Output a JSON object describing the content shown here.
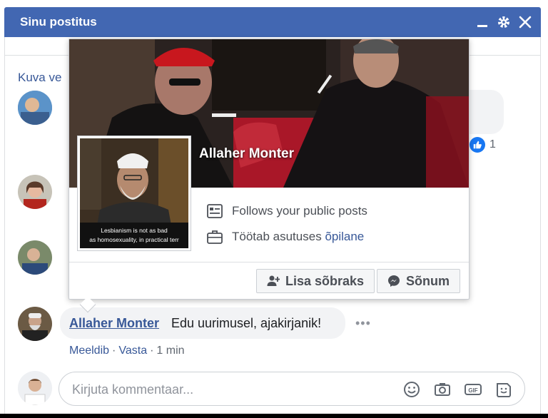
{
  "window": {
    "title": "Sinu postitus"
  },
  "thread": {
    "view_more_label": "Kuva ve",
    "like_count": "1"
  },
  "comment": {
    "author": "Allaher Monter",
    "text": "Edu uurimusel, ajakirjanik!",
    "more_label": "•••",
    "like_label": "Meeldib",
    "reply_label": "Vasta",
    "separator": "·",
    "time": "1 min"
  },
  "hovercard": {
    "name": "Allaher Monter",
    "follows_text": "Follows your public posts",
    "works_prefix": "Töötab asutuses",
    "works_link": "õpilane",
    "add_friend_label": "Lisa sõbraks",
    "message_label": "Sõnum",
    "profile_caption": "Lesbianism is not as bad as homosexuality, in practical terr"
  },
  "composer": {
    "placeholder": "Kirjuta kommentaar..."
  },
  "icons": {
    "minimize": "minimize-icon",
    "settings": "gear-icon",
    "close": "close-icon",
    "like": "thumbs-up-icon",
    "emoji": "emoji-icon",
    "camera": "camera-icon",
    "gif": "gif-icon",
    "sticker": "sticker-icon",
    "follow": "news-feed-icon",
    "work": "briefcase-icon",
    "add_friend": "add-friend-icon",
    "messenger": "messenger-icon"
  },
  "colors": {
    "header_blue": "#4267b2",
    "link_blue": "#385898",
    "like_blue": "#1877f2"
  }
}
